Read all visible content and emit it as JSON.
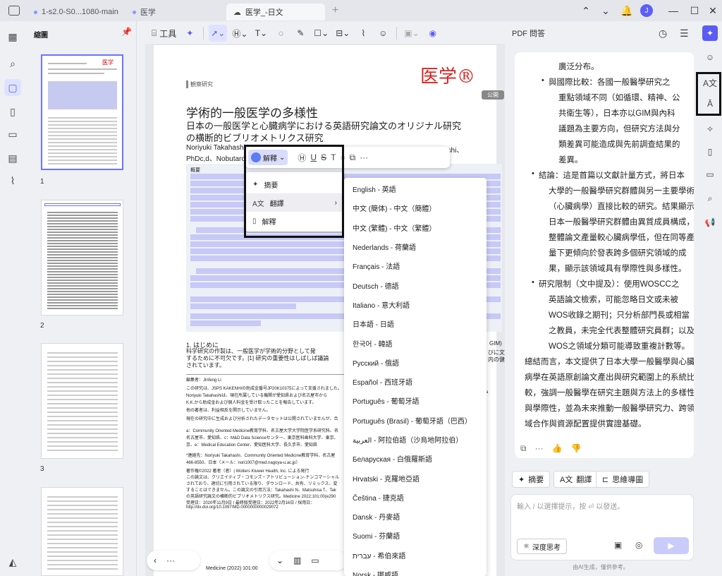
{
  "tabs": [
    {
      "label": "1-s2.0-S0...1080-main"
    },
    {
      "label": "医学"
    },
    {
      "label": "医学_-日文"
    }
  ],
  "left_panel": {
    "title": "縮圖",
    "page_numbers": [
      "1",
      "2",
      "3"
    ]
  },
  "toolbar": {
    "tools_label": "工具"
  },
  "document": {
    "logo": "医学®",
    "section_label": "観察研究",
    "tag": "公開",
    "title1": "学術的一般医学の多様性",
    "title2": "日本の一般医学と心臓病学における英語研究論文のオリジナル研究",
    "title3": "の横断的ビブリオメトリクス研究",
    "authors1": "Noriyuki Takahashi",
    "authors1b": "MD PhDb、Kunihiko Takahashi、",
    "authors2": "PhDc,d、Nobutaro",
    "abstract_label": "概要",
    "intro_heading": "1. はじめに",
    "intro1": "科学研究の作製は、一般医学が学術的分野として発",
    "intro1b": "GIM)",
    "intro2": "するために不可欠です。[1] 研究の重要性はしばしば議論",
    "intro2b": "びに文",
    "intro3": "されています。",
    "intro3b": "内の健",
    "editor": "編集者：Jinfeng Li",
    "footnote1": "この研究は、JSPS KAKENHIの助成金番号JP20K10375によって支援されました。",
    "footnote2": "Noriyuki Takahashiは、現在所属している機関が愛知県および名古屋市から",
    "footnote2b": "ma",
    "footnote3": "K.K.から助成金および個人料金を受け取ったことを報告しています。",
    "footnote4": "他の著者は、利益相反を開示していません。",
    "footnote5": "現在の研究中に生成および分析されたデータセットは公開されていませんが、合",
    "footnote6": "a：Community Oriented Medicine教育学科、名古屋大学大学院医学系研究科、名",
    "footnote7": "名古屋市、愛知県、c：M&D Data Scienceセンター、東京医科歯科大学、東京、",
    "footnote8": "京、e：Medical Education Center、愛知医科大学、長久手市、愛知県",
    "footnote9": "*連絡先：Noriyuki Takahashi、Community Oriented Medicine教育学科、名古屋",
    "footnote10": "466-8550、日本（メール：nori1007@med.nagoya-u.ac.jp）",
    "footnote11": "著作権©2022 著者（者）| Wolters Kluwer Health, Inc. による発行",
    "footnote12": "この論文は、クリエイティブ・コモンズ・アトリビューション-ナンコマーシャル",
    "footnote13": "されており、適切に引用されている限り、ダウンロード、共有、リミックス、変",
    "footnote14": "することはできません。この論文の引用方法：Takahashi N、Matsuhisa T、Tak",
    "footnote15": "の英語研究論文の横断的ビブリオメトリクス研究。Medicine 2022;101:00(e290",
    "footnote16": "受理日：2020年11月9日 / 最終版受理日：2022年2月16日 / 採用日：",
    "footnote17": "http://dx.doi.org/10.1097/MD.0000000000029072",
    "footer_text": "Medicine (2022) 101:00"
  },
  "float_toolbar": {
    "explain_label": "解釋"
  },
  "context_menu": [
    {
      "label": "摘要"
    },
    {
      "label": "翻譯"
    },
    {
      "label": "解釋"
    }
  ],
  "languages": [
    "English - 英語",
    "中文 (簡体) - 中文（簡體）",
    "中文 (繁體) - 中文（繁體）",
    "Nederlands - 荷蘭語",
    "Français - 法語",
    "Deutsch - 德語",
    "Italiano - 意大利語",
    "日本語 - 日語",
    "한국어 - 韓語",
    "Русский - 俄語",
    "Español - 西班牙語",
    "Português - 葡萄牙語",
    "Português (Brasil) - 葡萄牙語（巴西）",
    "العربية - 阿拉伯語（沙烏地阿拉伯）",
    "Беларуская - 白俄羅斯語",
    "Hrvatski - 克羅地亞語",
    "Čeština - 捷克語",
    "Dansk - 丹麥語",
    "Suomi - 芬蘭語",
    "עברית - 希伯來語",
    "Norsk - 挪威語"
  ],
  "qa": {
    "title": "PDF 問答",
    "lines": [
      "廣泛分布。",
      "與國際比較：各國一般醫學研究之",
      "重點領域不同（如循環、精神、公",
      "共衛生等），日本亦以GIM與內科",
      "議題為主要方向，但研究方法與分",
      "類差異可能造成與先前調查結果的",
      "差異。",
      "結論：這是首篇以文獻計量方式，將日本",
      "大學的一般醫學研究群體與另一主要學術專科",
      "（心臟病學）直接比較的研究。結果顯示",
      "日本一般醫學研究群體由異質成員構成，",
      "整體論文產量較心臟病學低，但在同等產",
      "量下更傾向於發表跨多個研究領域的成",
      "果，顯示該領域具有學際性與多樣性。",
      "研究限制（文中提及）：使用WOSCC之",
      "英語論文檢索，可能忽略日文或未被",
      "WOS收錄之期刊；只分析部門長或相當",
      "之教員，未完全代表整體研究員群；以及",
      "WOS之領域分類可能導致重複計數等。",
      "總結而言，本文提供了日本大學一般醫學與心臟",
      "病學在英語原創論文產出與研究範圍上的系統比",
      "較，強調一般醫學在研究主題與方法上的多樣性",
      "與學際性，並為未來推動一般醫學研究力、跨領",
      "域合作與資源配置提供實證基礎。"
    ],
    "chips": [
      "摘要",
      "翻譯",
      "思維導圖"
    ],
    "input_placeholder": "輸入 / 以選擇提示，按 ⏎ 以發送。",
    "deep_think": "深度思考",
    "footer": "由AI生成，僅供參考。"
  }
}
